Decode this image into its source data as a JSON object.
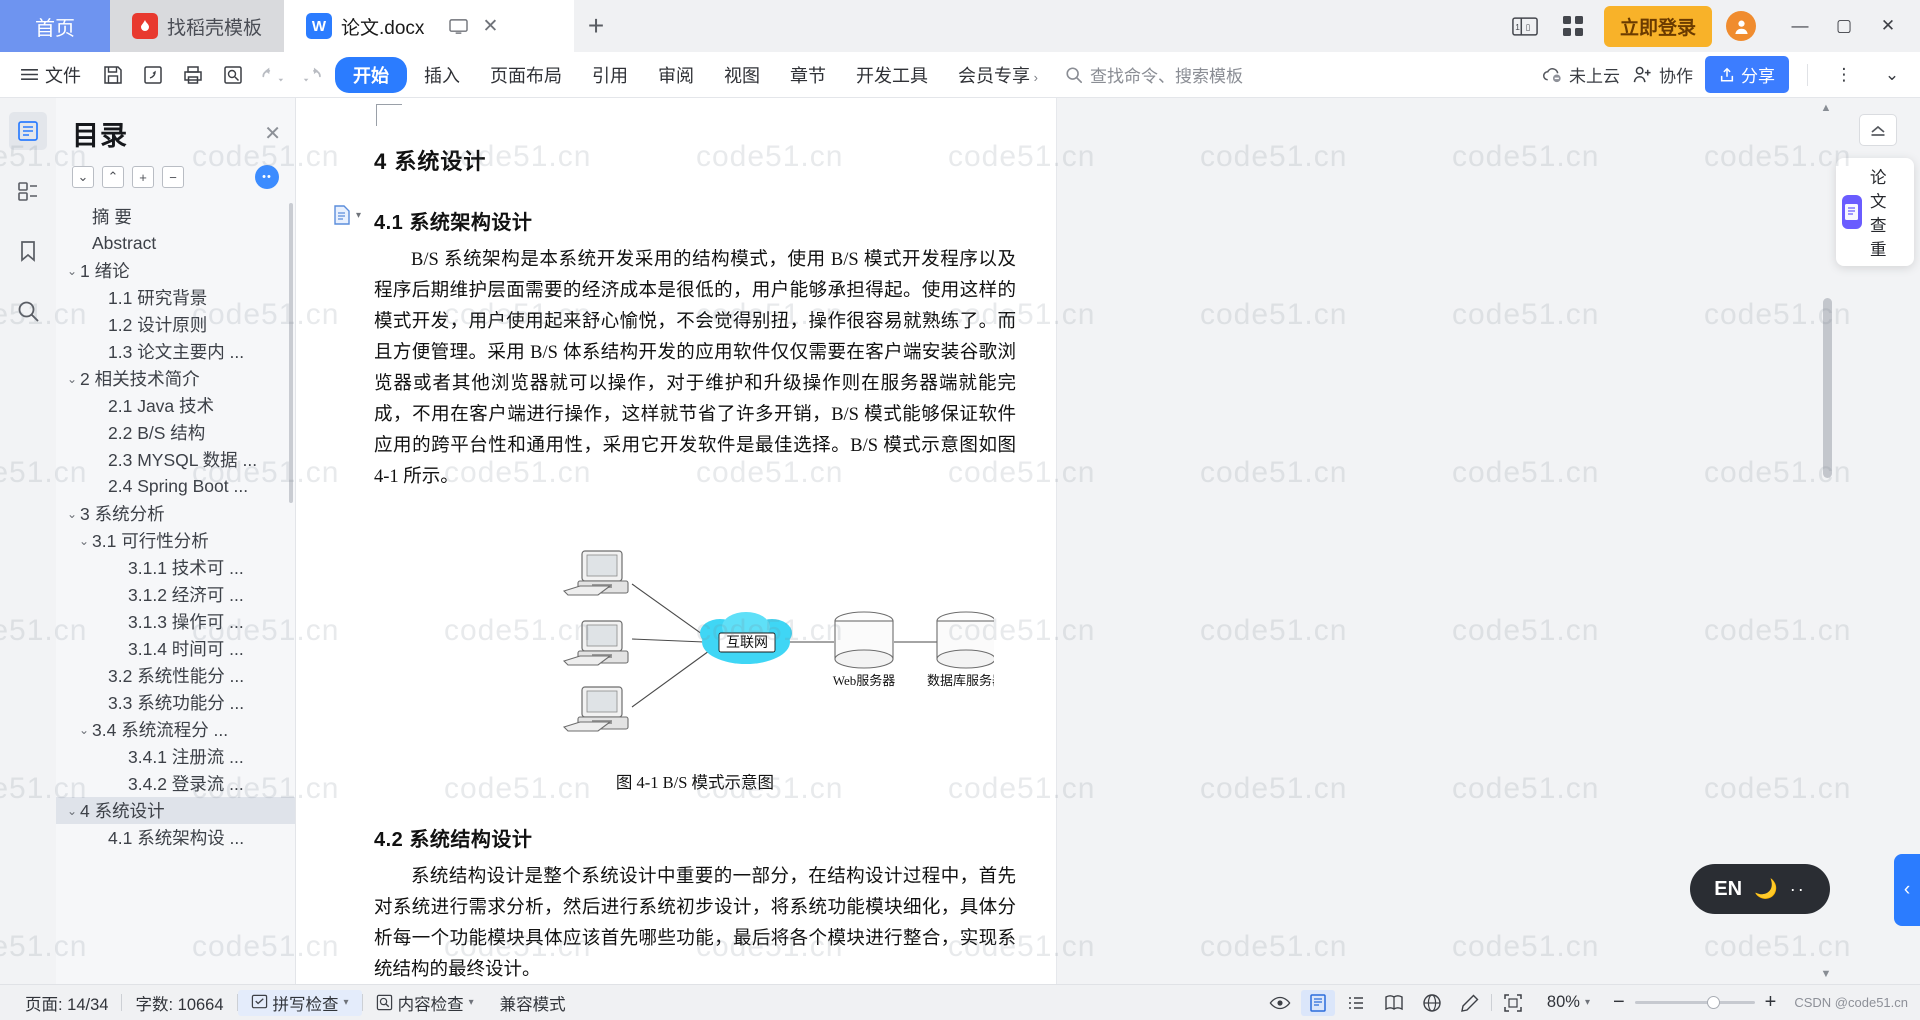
{
  "tabs": {
    "home": "首页",
    "template": "找稻壳模板",
    "document": "论文.docx",
    "new_tab": "+"
  },
  "titlebar": {
    "login_button": "立即登录",
    "minimize": "—",
    "maximize": "▢",
    "close": "✕"
  },
  "ribbon": {
    "file_menu": "文件",
    "tabs": [
      "开始",
      "插入",
      "页面布局",
      "引用",
      "审阅",
      "视图",
      "章节",
      "开发工具",
      "会员专享"
    ],
    "active_tab": "开始",
    "search_placeholder": "查找命令、搜索模板",
    "cloud_status": "未上云",
    "collaborate": "协作",
    "share": "分享"
  },
  "toc": {
    "title": "目录",
    "items": [
      {
        "label": "摘 要",
        "level": 1,
        "chevron": "",
        "selected": false
      },
      {
        "label": "Abstract",
        "level": 1,
        "chevron": "",
        "selected": false
      },
      {
        "label": "1 绪论",
        "level": 0,
        "chevron": "⌄",
        "selected": false
      },
      {
        "label": "1.1 研究背景",
        "level": 2,
        "chevron": "",
        "selected": false
      },
      {
        "label": "1.2 设计原则",
        "level": 2,
        "chevron": "",
        "selected": false
      },
      {
        "label": "1.3 论文主要内 ...",
        "level": 2,
        "chevron": "",
        "selected": false
      },
      {
        "label": "2 相关技术简介",
        "level": 0,
        "chevron": "⌄",
        "selected": false
      },
      {
        "label": "2.1 Java 技术",
        "level": 2,
        "chevron": "",
        "selected": false
      },
      {
        "label": "2.2 B/S 结构",
        "level": 2,
        "chevron": "",
        "selected": false
      },
      {
        "label": "2.3 MYSQL 数据 ...",
        "level": 2,
        "chevron": "",
        "selected": false
      },
      {
        "label": "2.4 Spring Boot ...",
        "level": 2,
        "chevron": "",
        "selected": false
      },
      {
        "label": "3 系统分析",
        "level": 0,
        "chevron": "⌄",
        "selected": false
      },
      {
        "label": "3.1 可行性分析",
        "level": 1,
        "chevron": "⌄",
        "selected": false
      },
      {
        "label": "3.1.1 技术可 ...",
        "level": 3,
        "chevron": "",
        "selected": false
      },
      {
        "label": "3.1.2 经济可 ...",
        "level": 3,
        "chevron": "",
        "selected": false
      },
      {
        "label": "3.1.3 操作可 ...",
        "level": 3,
        "chevron": "",
        "selected": false
      },
      {
        "label": "3.1.4 时间可 ...",
        "level": 3,
        "chevron": "",
        "selected": false
      },
      {
        "label": "3.2 系统性能分 ...",
        "level": 2,
        "chevron": "",
        "selected": false
      },
      {
        "label": "3.3 系统功能分 ...",
        "level": 2,
        "chevron": "",
        "selected": false
      },
      {
        "label": "3.4 系统流程分 ...",
        "level": 1,
        "chevron": "⌄",
        "selected": false
      },
      {
        "label": "3.4.1 注册流 ...",
        "level": 3,
        "chevron": "",
        "selected": false
      },
      {
        "label": "3.4.2 登录流 ...",
        "level": 3,
        "chevron": "",
        "selected": false
      },
      {
        "label": "4 系统设计",
        "level": 0,
        "chevron": "⌄",
        "selected": true
      },
      {
        "label": "4.1 系统架构设 ...",
        "level": 2,
        "chevron": "",
        "selected": false
      }
    ]
  },
  "document": {
    "heading1": "4 系统设计",
    "heading2a": "4.1 系统架构设计",
    "paragraph1": "B/S 系统架构是本系统开发采用的结构模式，使用 B/S 模式开发程序以及程序后期维护层面需要的经济成本是很低的，用户能够承担得起。使用这样的模式开发，用户使用起来舒心愉悦，不会觉得别扭，操作很容易就熟练了。而且方便管理。采用 B/S 体系结构开发的应用软件仅仅需要在客户端安装谷歌浏览器或者其他浏览器就可以操作，对于维护和升级操作则在服务器端就能完成，不用在客户端进行操作，这样就节省了许多开销，B/S 模式能够保证软件应用的跨平台性和通用性，采用它开发软件是最佳选择。B/S 模式示意图如图 4-1 所示。",
    "figure_caption": "图 4-1 B/S 模式示意图",
    "figure_labels": {
      "internet": "互联网",
      "web_server": "Web服务器",
      "db_server": "数据库服务器"
    },
    "heading2b": "4.2 系统结构设计",
    "paragraph2": "系统结构设计是整个系统设计中重要的一部分，在结构设计过程中，首先对系统进行需求分析，然后进行系统初步设计，将系统功能模块细化，具体分析每一个功能模块具体应该首先哪些功能，最后将各个模块进行整合，实现系统结构的最终设计。"
  },
  "right_panel": {
    "check_label": "论文查重"
  },
  "floating": {
    "lang": "EN",
    "moon_icon": "moon-icon",
    "dots_icon": "dots-icon"
  },
  "statusbar": {
    "page": "页面: 14/34",
    "words": "字数: 10664",
    "spell_check": "拼写检查",
    "content_check": "内容检查",
    "compat_mode": "兼容模式",
    "zoom": "80%",
    "zoom_out": "−",
    "zoom_in": "+",
    "watermark_credit": "CSDN @code51.cn"
  },
  "watermark": {
    "text": "code51.cn"
  },
  "colors": {
    "accent_blue": "#2b7cff",
    "tab_home_blue": "#6e94f0",
    "login_yellow": "#f8b229",
    "purple_chip": "#6a5cff",
    "internet_cyan": "#2fd0f0"
  }
}
